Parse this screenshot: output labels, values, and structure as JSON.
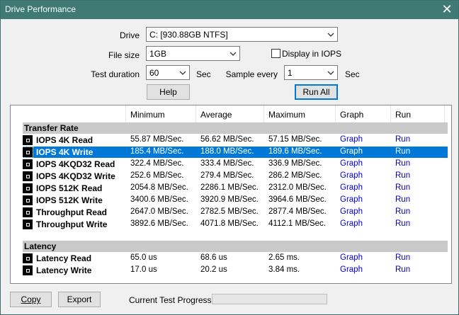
{
  "window": {
    "title": "Drive Performance"
  },
  "form": {
    "drive_label": "Drive",
    "drive_value": "C: [930.88GB NTFS]",
    "filesize_label": "File size",
    "filesize_value": "1GB",
    "display_iops_label": "Display in IOPS",
    "display_iops_checked": false,
    "duration_label": "Test duration",
    "duration_value": "60",
    "duration_unit": "Sec",
    "sample_label": "Sample every",
    "sample_value": "1",
    "sample_unit": "Sec",
    "help_label": "Help",
    "runall_label": "Run All"
  },
  "table": {
    "columns": [
      "Minimum",
      "Average",
      "Maximum",
      "Graph",
      "Run"
    ],
    "groups": [
      {
        "title": "Transfer Rate",
        "rows": [
          {
            "name": "IOPS 4K Read",
            "min": "55.87 MB/Sec.",
            "avg": "56.62 MB/Sec.",
            "max": "57.15 MB/Sec.",
            "graph": "Graph",
            "run": "Run",
            "selected": false
          },
          {
            "name": "IOPS 4K Write",
            "min": "185.4 MB/Sec.",
            "avg": "188.0 MB/Sec.",
            "max": "189.6 MB/Sec.",
            "graph": "Graph",
            "run": "Run",
            "selected": true
          },
          {
            "name": "IOPS 4KQD32 Read",
            "min": "322.4 MB/Sec.",
            "avg": "333.4 MB/Sec.",
            "max": "336.9 MB/Sec.",
            "graph": "Graph",
            "run": "Run",
            "selected": false
          },
          {
            "name": "IOPS 4KQD32 Write",
            "min": "252.6 MB/Sec.",
            "avg": "279.4 MB/Sec.",
            "max": "286.2 MB/Sec.",
            "graph": "Graph",
            "run": "Run",
            "selected": false
          },
          {
            "name": "IOPS 512K Read",
            "min": "2054.8 MB/Sec.",
            "avg": "2286.1 MB/Sec.",
            "max": "2312.0 MB/Sec.",
            "graph": "Graph",
            "run": "Run",
            "selected": false
          },
          {
            "name": "IOPS 512K Write",
            "min": "3400.6 MB/Sec.",
            "avg": "3920.9 MB/Sec.",
            "max": "3964.6 MB/Sec.",
            "graph": "Graph",
            "run": "Run",
            "selected": false
          },
          {
            "name": "Throughput Read",
            "min": "2647.0 MB/Sec.",
            "avg": "2782.5 MB/Sec.",
            "max": "2877.4 MB/Sec.",
            "graph": "Graph",
            "run": "Run",
            "selected": false
          },
          {
            "name": "Throughput Write",
            "min": "3892.6 MB/Sec.",
            "avg": "4071.8 MB/Sec.",
            "max": "4112.1 MB/Sec.",
            "graph": "Graph",
            "run": "Run",
            "selected": false
          }
        ]
      },
      {
        "title": "Latency",
        "rows": [
          {
            "name": "Latency Read",
            "min": "65.0 us",
            "avg": "68.6 us",
            "max": "2.65 ms.",
            "graph": "Graph",
            "run": "Run",
            "selected": false
          },
          {
            "name": "Latency Write",
            "min": "17.0 us",
            "avg": "20.2 us",
            "max": "3.84 ms.",
            "graph": "Graph",
            "run": "Run",
            "selected": false
          }
        ]
      }
    ]
  },
  "footer": {
    "copy_label": "Copy",
    "export_label": "Export",
    "progress_label": "Current Test Progress",
    "progress_value": 0
  },
  "colors": {
    "titlebar": "#3f7a74",
    "selection": "#0078d7",
    "link": "#0000d0",
    "group_band": "#c9c9c9"
  }
}
